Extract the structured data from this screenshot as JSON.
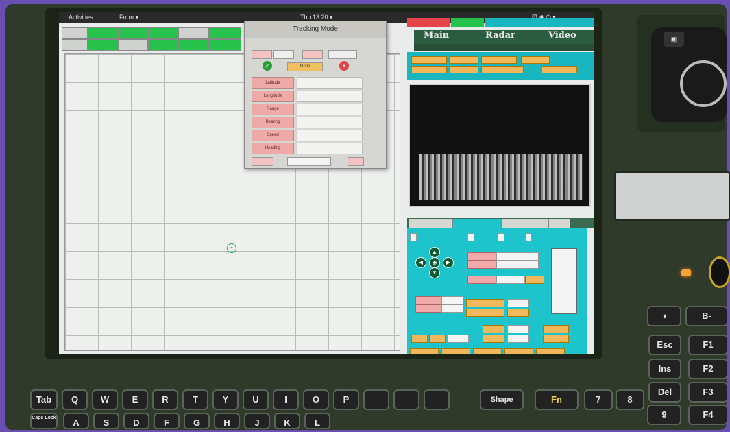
{
  "topbar": {
    "activities": "Activities",
    "app_menu": "Form ▾",
    "clock": "Thu 13:20 ▾",
    "sys_icons": "⚂ ◉ ⏻ ▾"
  },
  "toolbar": {
    "row1": [
      "",
      "",
      " ",
      "",
      "",
      ""
    ],
    "row2": [
      "",
      "",
      "",
      "",
      "",
      ""
    ]
  },
  "tracking_dialog": {
    "title": "Tracking Mode",
    "top_pills": [
      "",
      "",
      "",
      ""
    ],
    "ok_icon": "✓",
    "mode_button": "Mode",
    "cancel_icon": "✕",
    "fields": [
      {
        "label": "Latitude",
        "value": ""
      },
      {
        "label": "Longitude",
        "value": ""
      },
      {
        "label": "Range",
        "value": ""
      },
      {
        "label": "Bearing",
        "value": ""
      },
      {
        "label": "Speed",
        "value": ""
      },
      {
        "label": "Heading",
        "value": ""
      }
    ],
    "bottom_select": "",
    "bottom_btn": ""
  },
  "right_panel": {
    "status": {
      "left": "",
      "mid": "",
      "right": ""
    },
    "main_tabs": [
      "Main",
      "Radar",
      "Video"
    ],
    "sub_tabs": [
      "",
      "",
      "",
      ""
    ],
    "options": {
      "checks": [
        "",
        "",
        "",
        ""
      ]
    },
    "dpad": {
      "up": "▲",
      "down": "▼",
      "left": "◀",
      "right": "▶",
      "center": "◉"
    },
    "section_header": "",
    "bottom_title": "",
    "bottom_buttons": [
      "",
      "",
      "",
      "",
      ""
    ]
  },
  "hardware": {
    "logo_text": "",
    "cam_icon": "▣",
    "keys_side": [
      "◑",
      "B-",
      "Esc",
      "F1",
      "Ins",
      "F2",
      "Del",
      "F3",
      "F4"
    ],
    "keys_row1": [
      "Tab",
      "Q",
      "W",
      "E",
      "R",
      "T",
      "Y",
      "U",
      "I",
      "O",
      "P",
      "",
      "",
      "",
      "Shape",
      "Fn",
      "7",
      "8",
      "9"
    ],
    "keys_row2": [
      "Caps Lock",
      "A",
      "S",
      "D",
      "F",
      "G",
      "H",
      "J",
      "K",
      "L"
    ]
  },
  "colors": {
    "green": "#27c24c",
    "teal": "#1ec4cc",
    "pink": "#efa9a9",
    "orange": "#f0b85a",
    "bezel": "#2f3a2a"
  }
}
